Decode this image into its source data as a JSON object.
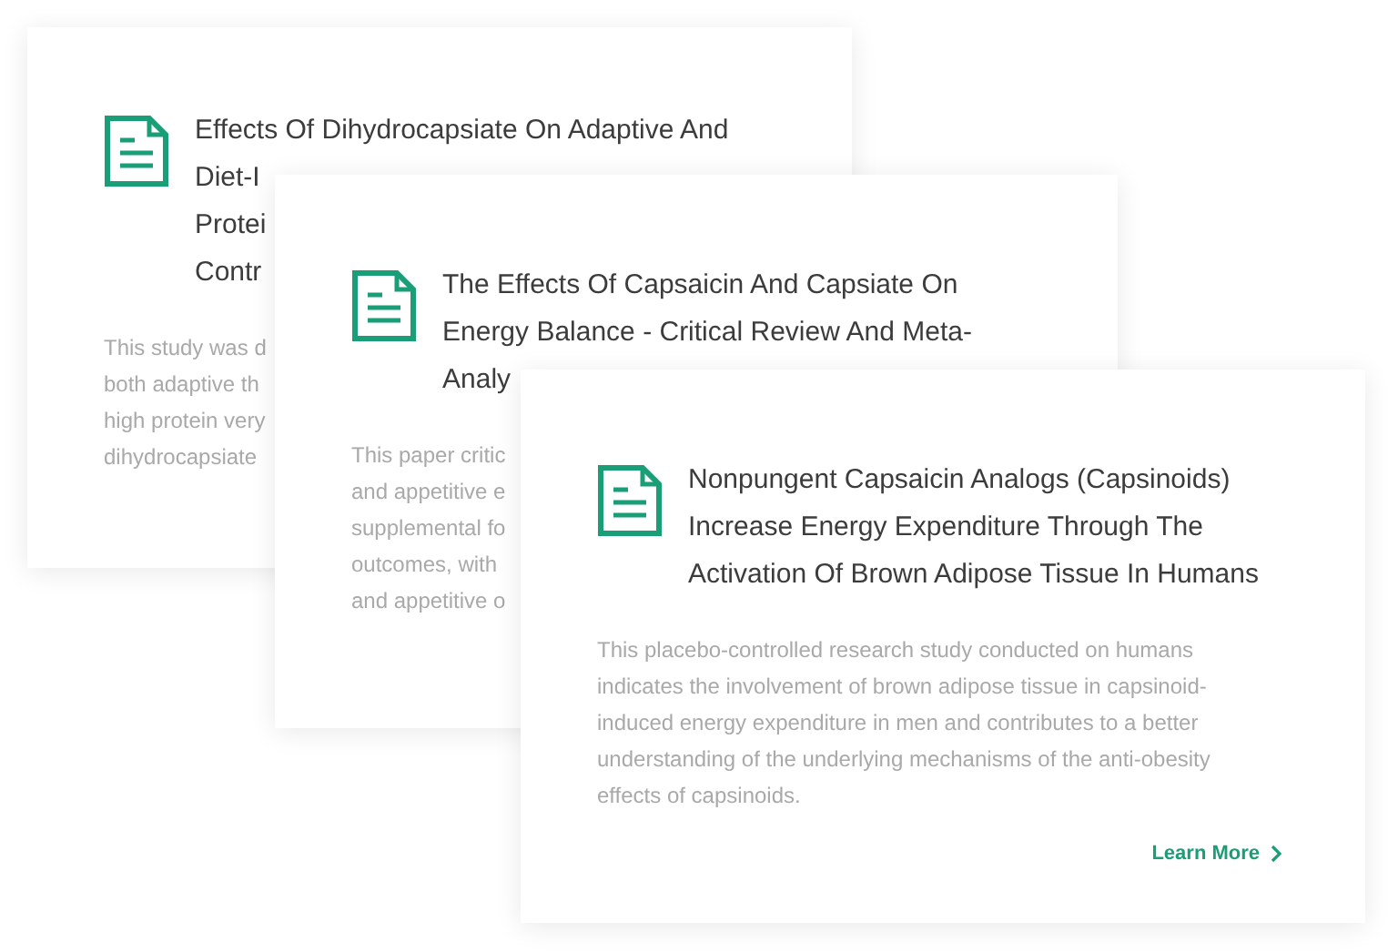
{
  "cards": [
    {
      "title_lines": [
        "Effects Of Dihydrocapsiate On Adaptive And",
        "Diet-I",
        "Protei",
        "Contr"
      ],
      "body_lines": [
        "This study was d",
        "both adaptive th",
        "high protein very",
        "dihydrocapsiate"
      ]
    },
    {
      "title_lines": [
        "The Effects Of Capsaicin And Capsiate On",
        "Energy Balance - Critical Review And Meta-",
        "Analy"
      ],
      "body_lines": [
        "This paper critic",
        "and appetitive e",
        "supplemental fo",
        "outcomes, with",
        "and appetitive o"
      ]
    },
    {
      "title_lines": [
        "Nonpungent Capsaicin Analogs (Capsinoids)",
        "Increase Energy Expenditure Through The",
        "Activation Of Brown Adipose Tissue In Humans"
      ],
      "body_lines": [
        "This placebo-controlled research study conducted on humans",
        "indicates the involvement of brown adipose tissue in capsinoid-",
        "induced energy expenditure in men and contributes to a better",
        "understanding of the underlying mechanisms of the anti-obesity",
        "effects of capsinoids."
      ],
      "link": "Learn More"
    }
  ]
}
